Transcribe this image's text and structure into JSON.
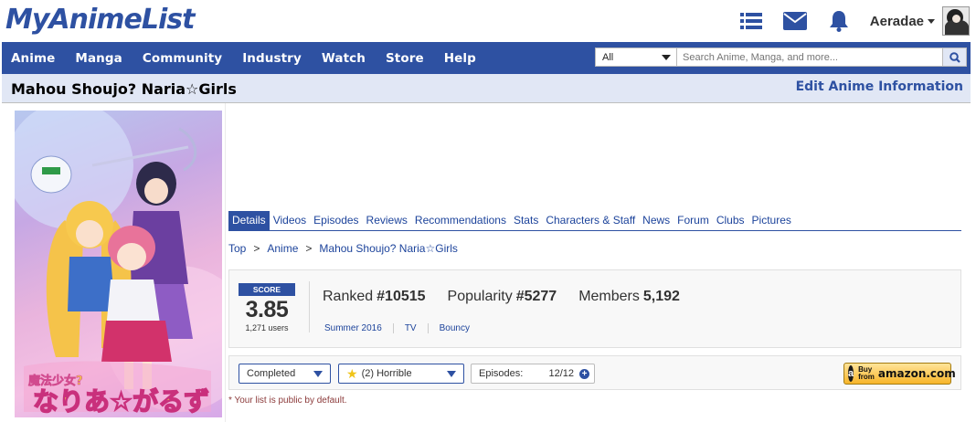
{
  "site": {
    "logo": "MyAnimeList"
  },
  "header": {
    "username": "Aeradae",
    "icons": [
      "list-icon",
      "mail-icon",
      "bell-icon"
    ]
  },
  "nav": {
    "items": [
      "Anime",
      "Manga",
      "Community",
      "Industry",
      "Watch",
      "Store",
      "Help"
    ],
    "search": {
      "category": "All",
      "placeholder": "Search Anime, Manga, and more..."
    }
  },
  "title_bar": {
    "title": "Mahou Shoujo? Naria☆Girls",
    "edit_link": "Edit Anime Information"
  },
  "tabs": {
    "items": [
      "Details",
      "Videos",
      "Episodes",
      "Reviews",
      "Recommendations",
      "Stats",
      "Characters & Staff",
      "News",
      "Forum",
      "Clubs",
      "Pictures"
    ],
    "active": "Details"
  },
  "breadcrumb": [
    "Top",
    "Anime",
    "Mahou Shoujo? Naria☆Girls"
  ],
  "stats": {
    "score_label": "SCORE",
    "score": "3.85",
    "score_users": "1,271 users",
    "ranked_label": "Ranked",
    "ranked_value": "#10515",
    "popularity_label": "Popularity",
    "popularity_value": "#5277",
    "members_label": "Members",
    "members_value": "5,192",
    "season": "Summer 2016",
    "type": "TV",
    "studio": "Bouncy"
  },
  "list": {
    "status": "Completed",
    "rating": "(2) Horrible",
    "episodes_label": "Episodes:",
    "episodes_value": "12/12",
    "amazon_buy": "Buy",
    "amazon_from": "from",
    "amazon_brand": "amazon.com",
    "public_note": "* Your list is public by default."
  },
  "colors": {
    "brand": "#2e51a2",
    "title_bar_bg": "#e1e7f5"
  }
}
